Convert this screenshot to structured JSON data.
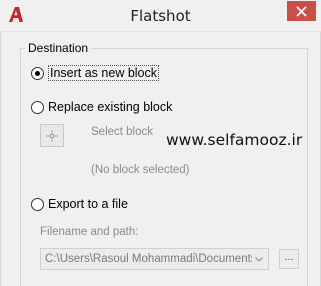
{
  "window": {
    "title": "Flatshot",
    "app_icon": "autocad-icon",
    "close_icon": "close-icon"
  },
  "destination": {
    "legend": "Destination",
    "options": [
      {
        "label": "Insert as new block",
        "checked": true
      },
      {
        "label": "Replace existing block",
        "checked": false
      },
      {
        "label": "Export to a file",
        "checked": false
      }
    ],
    "select_block_label": "Select block",
    "no_block_selected": "(No block selected)",
    "filename_label": "Filename and path:",
    "filename_value": "C:\\Users\\Rasoul Mohammadi\\Documents\\n",
    "browse_label": "..."
  },
  "watermark": "www.selfamooz.ir"
}
